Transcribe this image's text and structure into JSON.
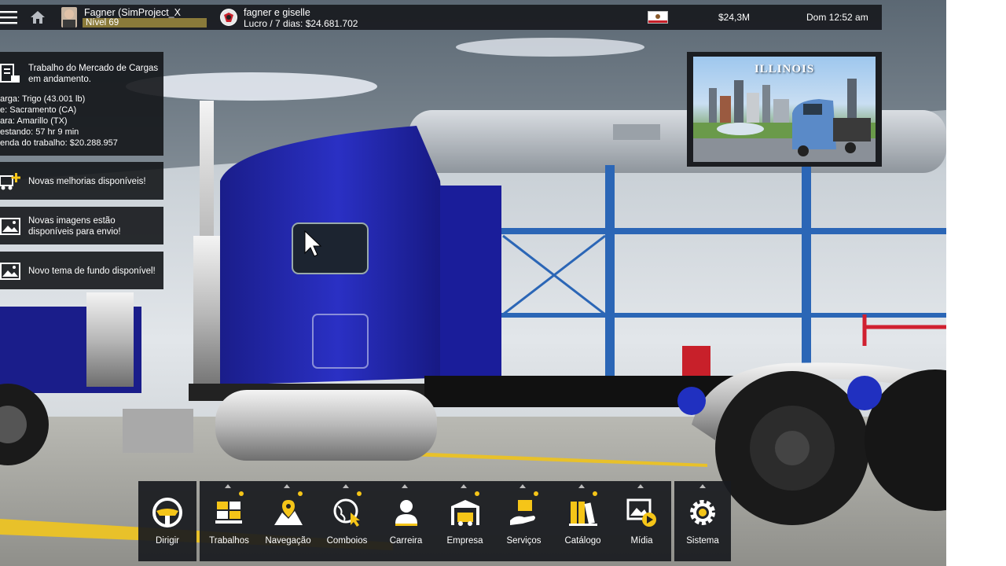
{
  "topbar": {
    "player_name": "Fagner (SimProject_X",
    "player_level": "Nível 69",
    "company_name": "fagner e giselle",
    "company_profit": "Lucro / 7 dias: $24.681.702",
    "money": "$24,3M",
    "clock": "Dom 12:52 am"
  },
  "job": {
    "title_line1": "Trabalho do Mercado de Cargas",
    "title_line2": "em andamento.",
    "cargo_label": "arga:",
    "cargo_value": "Trigo (43.001 lb)",
    "from_label": "e:",
    "from_value": "Sacramento (CA)",
    "to_label": "ara:",
    "to_value": "Amarillo (TX)",
    "remaining_label": "estando:",
    "remaining_value": "57 hr 9 min",
    "income_label": "enda do trabalho:",
    "income_value": "$20.288.957"
  },
  "notifications": [
    {
      "text": "Novas melhorias disponíveis!"
    },
    {
      "line1": "Novas imagens estão",
      "line2": "disponíveis para envio!"
    },
    {
      "text": "Novo tema de fundo disponível!"
    }
  ],
  "region_card": {
    "title": "ILLINOIS"
  },
  "toolbar": {
    "drive": "Dirigir",
    "items": [
      "Trabalhos",
      "Navegação",
      "Comboios",
      "Carreira",
      "Empresa",
      "Serviços",
      "Catálogo",
      "Mídia"
    ],
    "system": "Sistema"
  },
  "colors": {
    "accent_yellow": "#f5c518",
    "bar_bg": "#14161a",
    "truck_blue": "#1f22a8"
  }
}
